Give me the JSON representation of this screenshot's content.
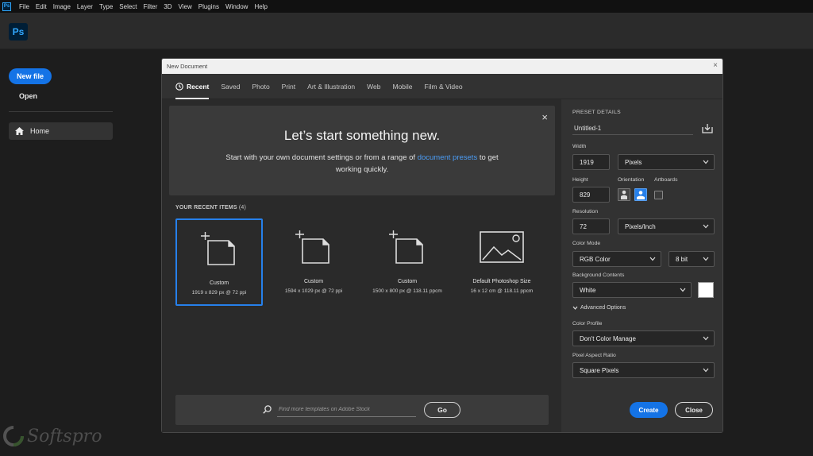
{
  "menubar": {
    "app_icon": "Ps",
    "items": [
      "File",
      "Edit",
      "Image",
      "Layer",
      "Type",
      "Select",
      "Filter",
      "3D",
      "View",
      "Plugins",
      "Window",
      "Help"
    ]
  },
  "appbar": {
    "logo": "Ps"
  },
  "sidebar": {
    "new_file": "New file",
    "open": "Open",
    "home": "Home"
  },
  "watermark": "Softspro",
  "dialog": {
    "title": "New Document",
    "close_glyph": "×",
    "tabs": [
      {
        "label": "Recent",
        "active": true,
        "icon": "clock-icon"
      },
      {
        "label": "Saved"
      },
      {
        "label": "Photo"
      },
      {
        "label": "Print"
      },
      {
        "label": "Art & Illustration"
      },
      {
        "label": "Web"
      },
      {
        "label": "Mobile"
      },
      {
        "label": "Film & Video"
      }
    ],
    "hero": {
      "title": "Let’s start something new.",
      "text_before": "Start with your own document settings or from a range of ",
      "link": "document presets",
      "text_after": " to get working quickly.",
      "close_glyph": "×"
    },
    "recent": {
      "heading": "YOUR RECENT ITEMS",
      "count": "(4)",
      "items": [
        {
          "name": "Custom",
          "desc": "1919 x 829 px @ 72 ppi",
          "selected": true,
          "icon": "custom-doc-icon"
        },
        {
          "name": "Custom",
          "desc": "1594 x 1029 px @ 72 ppi",
          "icon": "custom-doc-icon"
        },
        {
          "name": "Custom",
          "desc": "1500 x 800 px @ 118.11 ppcm",
          "icon": "custom-doc-icon"
        },
        {
          "name": "Default Photoshop Size",
          "desc": "16 x 12 cm @ 118.11 ppcm",
          "icon": "image-placeholder-icon"
        }
      ]
    },
    "search": {
      "placeholder": "Find more templates on Adobe Stock",
      "go": "Go"
    },
    "preset": {
      "heading": "PRESET DETAILS",
      "name": "Untitled-1",
      "width_label": "Width",
      "width": "1919",
      "width_unit": "Pixels",
      "height_label": "Height",
      "height": "829",
      "orientation_label": "Orientation",
      "orientation_selected": "landscape",
      "artboards_label": "Artboards",
      "artboards_checked": false,
      "resolution_label": "Resolution",
      "resolution": "72",
      "resolution_unit": "Pixels/Inch",
      "color_mode_label": "Color Mode",
      "color_mode": "RGB Color",
      "bit_depth": "8 bit",
      "bg_label": "Background Contents",
      "bg": "White",
      "bg_color": "#ffffff",
      "advanced": "Advanced Options",
      "profile_label": "Color Profile",
      "profile": "Don't Color Manage",
      "aspect_label": "Pixel Aspect Ratio",
      "aspect": "Square Pixels",
      "create": "Create",
      "close": "Close"
    }
  },
  "colors": {
    "accent": "#1473e6",
    "link": "#4b9cf5",
    "selection": "#2680eb"
  }
}
